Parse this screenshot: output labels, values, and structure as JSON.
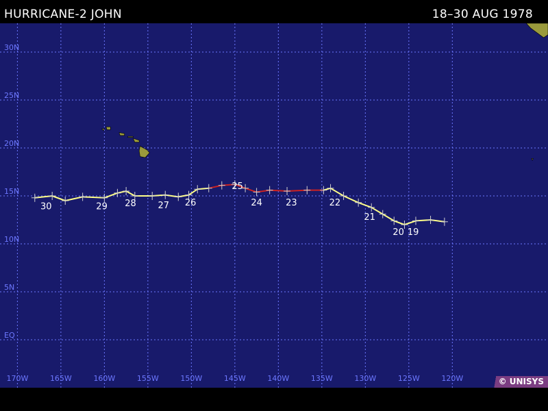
{
  "header": {
    "storm_title": "HURRICANE-2 JOHN",
    "date_range": "18–30 AUG 1978"
  },
  "credit": "© UNISYS",
  "colors": {
    "ocean": "#181a6b",
    "grid": "#6d78ff",
    "land": "#9a9a3c",
    "hurricane_track": "#ffff88",
    "major_track": "#cc2222",
    "tick_marks": "#cfcfcf"
  },
  "map": {
    "lon_range": [
      -172,
      -109
    ],
    "lat_range": [
      -5,
      33
    ],
    "lat_labels": [
      {
        "lat": 30,
        "label": "30N"
      },
      {
        "lat": 25,
        "label": "25N"
      },
      {
        "lat": 20,
        "label": "20N"
      },
      {
        "lat": 15,
        "label": "15N"
      },
      {
        "lat": 10,
        "label": "10N"
      },
      {
        "lat": 5,
        "label": "5N"
      },
      {
        "lat": 0,
        "label": "EQ"
      }
    ],
    "lon_labels": [
      {
        "lon": -170,
        "label": "170W"
      },
      {
        "lon": -165,
        "label": "165W"
      },
      {
        "lon": -160,
        "label": "160W"
      },
      {
        "lon": -155,
        "label": "155W"
      },
      {
        "lon": -150,
        "label": "150W"
      },
      {
        "lon": -145,
        "label": "145W"
      },
      {
        "lon": -140,
        "label": "140W"
      },
      {
        "lon": -135,
        "label": "135W"
      },
      {
        "lon": -130,
        "label": "130W"
      },
      {
        "lon": -125,
        "label": "125W"
      },
      {
        "lon": -120,
        "label": "120W"
      }
    ]
  },
  "track": [
    {
      "lon": -120.9,
      "lat": 12.3,
      "cat": "H"
    },
    {
      "lon": -122.5,
      "lat": 12.5,
      "cat": "H"
    },
    {
      "lon": -124.2,
      "lat": 12.4,
      "cat": "H"
    },
    {
      "lon": -125.5,
      "lat": 12.0,
      "cat": "H"
    },
    {
      "lon": -126.7,
      "lat": 12.4,
      "cat": "H"
    },
    {
      "lon": -128.0,
      "lat": 13.1,
      "cat": "H"
    },
    {
      "lon": -129.3,
      "lat": 13.8,
      "cat": "H"
    },
    {
      "lon": -130.8,
      "lat": 14.3,
      "cat": "H"
    },
    {
      "lon": -132.5,
      "lat": 15.0,
      "cat": "H"
    },
    {
      "lon": -134.0,
      "lat": 15.8,
      "cat": "H"
    },
    {
      "lon": -134.8,
      "lat": 15.6,
      "cat": "M"
    },
    {
      "lon": -136.7,
      "lat": 15.6,
      "cat": "M"
    },
    {
      "lon": -139.0,
      "lat": 15.5,
      "cat": "M"
    },
    {
      "lon": -141.0,
      "lat": 15.6,
      "cat": "M"
    },
    {
      "lon": -142.5,
      "lat": 15.4,
      "cat": "M"
    },
    {
      "lon": -143.8,
      "lat": 15.8,
      "cat": "M"
    },
    {
      "lon": -145.0,
      "lat": 16.2,
      "cat": "M"
    },
    {
      "lon": -146.5,
      "lat": 16.1,
      "cat": "M"
    },
    {
      "lon": -148.0,
      "lat": 15.8,
      "cat": "M"
    },
    {
      "lon": -149.3,
      "lat": 15.7,
      "cat": "H"
    },
    {
      "lon": -150.3,
      "lat": 15.1,
      "cat": "H"
    },
    {
      "lon": -151.5,
      "lat": 14.9,
      "cat": "H"
    },
    {
      "lon": -153.0,
      "lat": 15.1,
      "cat": "H"
    },
    {
      "lon": -154.5,
      "lat": 15.0,
      "cat": "H"
    },
    {
      "lon": -156.5,
      "lat": 15.0,
      "cat": "H"
    },
    {
      "lon": -157.5,
      "lat": 15.5,
      "cat": "H"
    },
    {
      "lon": -158.5,
      "lat": 15.3,
      "cat": "H"
    },
    {
      "lon": -160.0,
      "lat": 14.8,
      "cat": "H"
    },
    {
      "lon": -162.5,
      "lat": 14.9,
      "cat": "H"
    },
    {
      "lon": -164.5,
      "lat": 14.5,
      "cat": "H"
    },
    {
      "lon": -166.0,
      "lat": 15.0,
      "cat": "H"
    },
    {
      "lon": -168.0,
      "lat": 14.8,
      "cat": "H"
    }
  ],
  "day_labels": [
    {
      "day": "19",
      "lon": -124.5,
      "lat": 11.7
    },
    {
      "day": "20",
      "lon": -126.2,
      "lat": 11.7
    },
    {
      "day": "21",
      "lon": -129.5,
      "lat": 13.3
    },
    {
      "day": "22",
      "lon": -133.5,
      "lat": 14.8
    },
    {
      "day": "23",
      "lon": -138.5,
      "lat": 14.8
    },
    {
      "day": "24",
      "lon": -142.5,
      "lat": 14.8
    },
    {
      "day": "25",
      "lon": -144.7,
      "lat": 16.5
    },
    {
      "day": "26",
      "lon": -150.1,
      "lat": 14.8
    },
    {
      "day": "27",
      "lon": -153.2,
      "lat": 14.5
    },
    {
      "day": "28",
      "lon": -157.0,
      "lat": 14.7
    },
    {
      "day": "29",
      "lon": -160.3,
      "lat": 14.4
    },
    {
      "day": "30",
      "lon": -166.7,
      "lat": 14.4
    }
  ],
  "land": [
    {
      "name": "hawaii-big-island",
      "points": [
        [
          -155.9,
          20.2
        ],
        [
          -155.1,
          19.8
        ],
        [
          -154.8,
          19.5
        ],
        [
          -155.3,
          19.0
        ],
        [
          -155.9,
          19.1
        ],
        [
          -156.0,
          19.7
        ]
      ]
    },
    {
      "name": "maui",
      "points": [
        [
          -156.7,
          21.0
        ],
        [
          -156.0,
          20.8
        ],
        [
          -156.0,
          20.6
        ],
        [
          -156.5,
          20.6
        ]
      ]
    },
    {
      "name": "molokai",
      "points": [
        [
          -157.3,
          21.2
        ],
        [
          -156.7,
          21.2
        ],
        [
          -156.7,
          21.1
        ],
        [
          -157.3,
          21.1
        ]
      ]
    },
    {
      "name": "oahu",
      "points": [
        [
          -158.3,
          21.6
        ],
        [
          -157.7,
          21.5
        ],
        [
          -157.7,
          21.3
        ],
        [
          -158.2,
          21.3
        ]
      ]
    },
    {
      "name": "kauai",
      "points": [
        [
          -159.8,
          22.2
        ],
        [
          -159.3,
          22.2
        ],
        [
          -159.3,
          21.9
        ],
        [
          -159.7,
          21.9
        ]
      ]
    },
    {
      "name": "niihau",
      "points": [
        [
          -160.3,
          22.0
        ],
        [
          -160.0,
          22.0
        ],
        [
          -160.1,
          21.8
        ]
      ]
    },
    {
      "name": "baja-coast",
      "points": [
        [
          -109,
          33
        ],
        [
          -111.5,
          33
        ],
        [
          -111.0,
          32.5
        ],
        [
          -109.5,
          31.5
        ],
        [
          -109,
          31.8
        ]
      ]
    },
    {
      "name": "revillagigedo",
      "points": [
        [
          -110.9,
          18.9
        ],
        [
          -110.7,
          18.9
        ],
        [
          -110.8,
          18.7
        ]
      ]
    }
  ]
}
